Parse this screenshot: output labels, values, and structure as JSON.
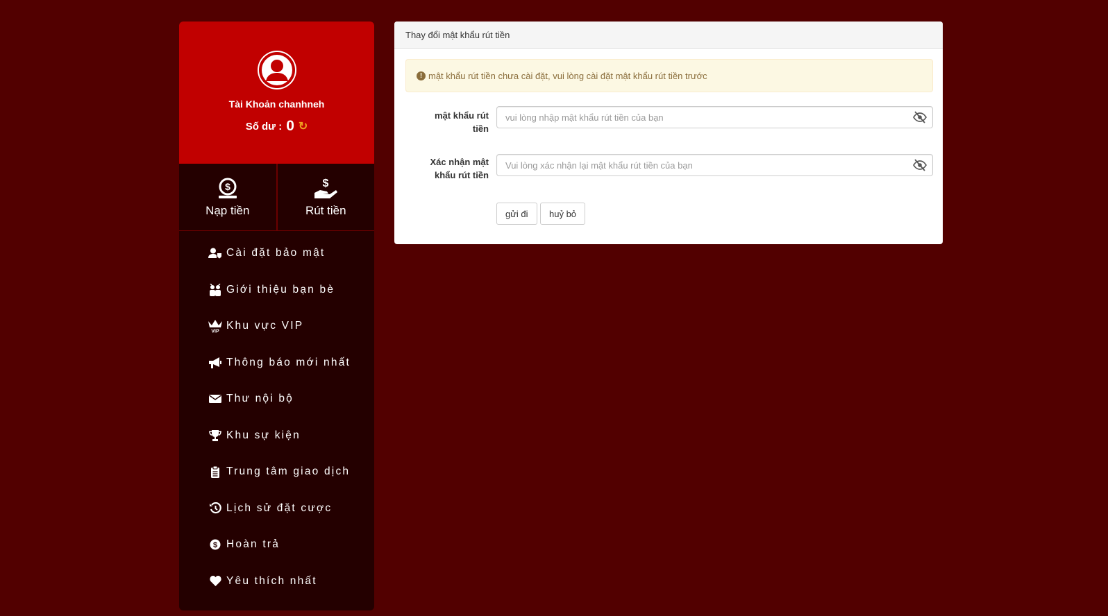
{
  "profile": {
    "account_label": "Tài Khoản",
    "username": "chanhneh",
    "balance_label": "Số dư :",
    "balance_value": "0"
  },
  "actions": [
    {
      "label": "Nạp tiền",
      "icon": "money-bag-icon"
    },
    {
      "label": "Rút tiền",
      "icon": "withdraw-hand-icon"
    }
  ],
  "menu": [
    {
      "label": "Cài đặt bảo mật",
      "icon": "user-shield-icon"
    },
    {
      "label": "Giới thiệu bạn bè",
      "icon": "friends-icon"
    },
    {
      "label": "Khu vực VIP",
      "icon": "vip-crown-icon"
    },
    {
      "label": "Thông báo mới nhất",
      "icon": "megaphone-icon"
    },
    {
      "label": "Thư nội bộ",
      "icon": "envelope-icon"
    },
    {
      "label": "Khu sự kiện",
      "icon": "trophy-icon"
    },
    {
      "label": "Trung tâm giao dịch",
      "icon": "clipboard-icon"
    },
    {
      "label": "Lịch sử đặt cược",
      "icon": "history-icon"
    },
    {
      "label": "Hoàn trả",
      "icon": "coin-icon"
    },
    {
      "label": "Yêu thích nhất",
      "icon": "heart-icon"
    }
  ],
  "panel": {
    "title": "Thay đổi mật khẩu rút tiền",
    "alert": "mật khẩu rút tiền chưa cài đặt, vui lòng cài đặt mật khẩu rút tiền trước",
    "fields": [
      {
        "label_line1": "mật khẩu rút",
        "label_line2": "tiền",
        "placeholder": "vui lòng nhập mật khẩu rút tiền của bạn",
        "value": ""
      },
      {
        "label_line1": "Xác nhận mật",
        "label_line2": "khẩu rút tiền",
        "placeholder": "Vui lòng xác nhận lại mật khẩu rút tiền của bạn",
        "value": ""
      }
    ],
    "submit_label": "gửi đi",
    "cancel_label": "huỷ bỏ"
  },
  "colors": {
    "page_bg": "#520000",
    "profile_bg": "#c10000",
    "sidebar_bg": "#240000",
    "refresh_icon": "#f0a020",
    "alert_bg": "#fcf8e3",
    "alert_text": "#8a6d3b"
  }
}
